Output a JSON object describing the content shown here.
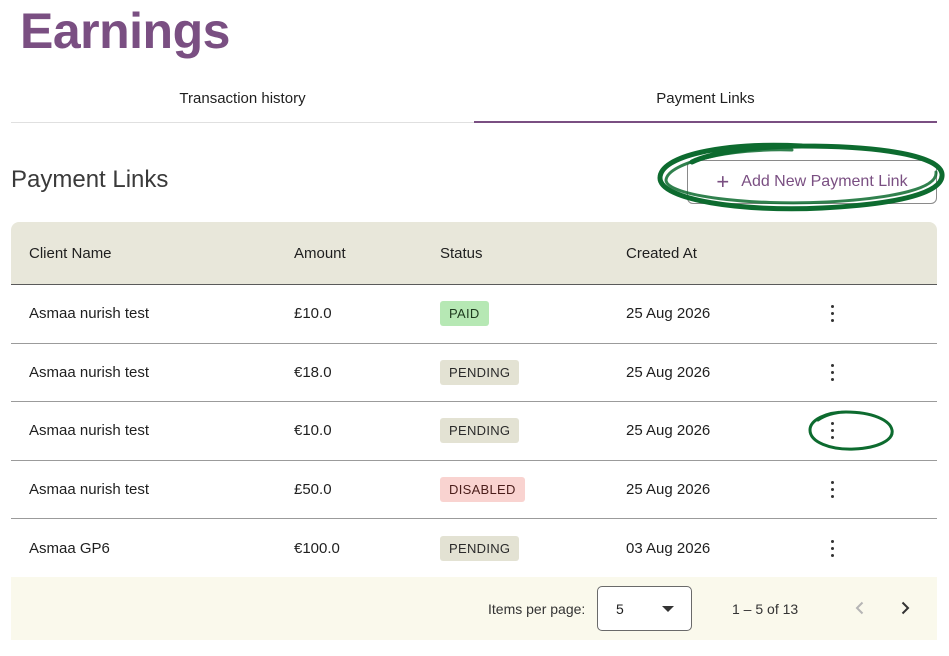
{
  "page": {
    "title": "Earnings"
  },
  "tabs": [
    {
      "label": "Transaction history",
      "active": false
    },
    {
      "label": "Payment Links",
      "active": true
    }
  ],
  "section": {
    "title": "Payment Links",
    "add_button_label": "Add New Payment Link"
  },
  "table": {
    "headers": [
      "Client Name",
      "Amount",
      "Status",
      "Created At"
    ],
    "rows": [
      {
        "client": "Asmaa nurish test",
        "amount": "£10.0",
        "status": "PAID",
        "created": "25 Aug 2026"
      },
      {
        "client": "Asmaa nurish test",
        "amount": "€18.0",
        "status": "PENDING",
        "created": "25 Aug 2026"
      },
      {
        "client": "Asmaa nurish test",
        "amount": "€10.0",
        "status": "PENDING",
        "created": "25 Aug 2026"
      },
      {
        "client": "Asmaa nurish test",
        "amount": "£50.0",
        "status": "DISABLED",
        "created": "25 Aug 2026"
      },
      {
        "client": "Asmaa GP6",
        "amount": "€100.0",
        "status": "PENDING",
        "created": "03 Aug 2026"
      }
    ]
  },
  "pagination": {
    "items_per_page_label": "Items per page:",
    "items_per_page_value": "5",
    "range_label": "1 – 5 of 13"
  },
  "colors": {
    "brand": "#7a4f82",
    "header_bg": "#e8e7da",
    "footer_bg": "#faf9ec",
    "paid": "#b6e8b4",
    "pending": "#e3e2d3",
    "disabled": "#f9d3d0",
    "annotation": "#0d6b2f"
  },
  "icons": [
    "plus-icon",
    "more-vert-icon",
    "chevron-down-icon",
    "chevron-left-icon",
    "chevron-right-icon"
  ]
}
